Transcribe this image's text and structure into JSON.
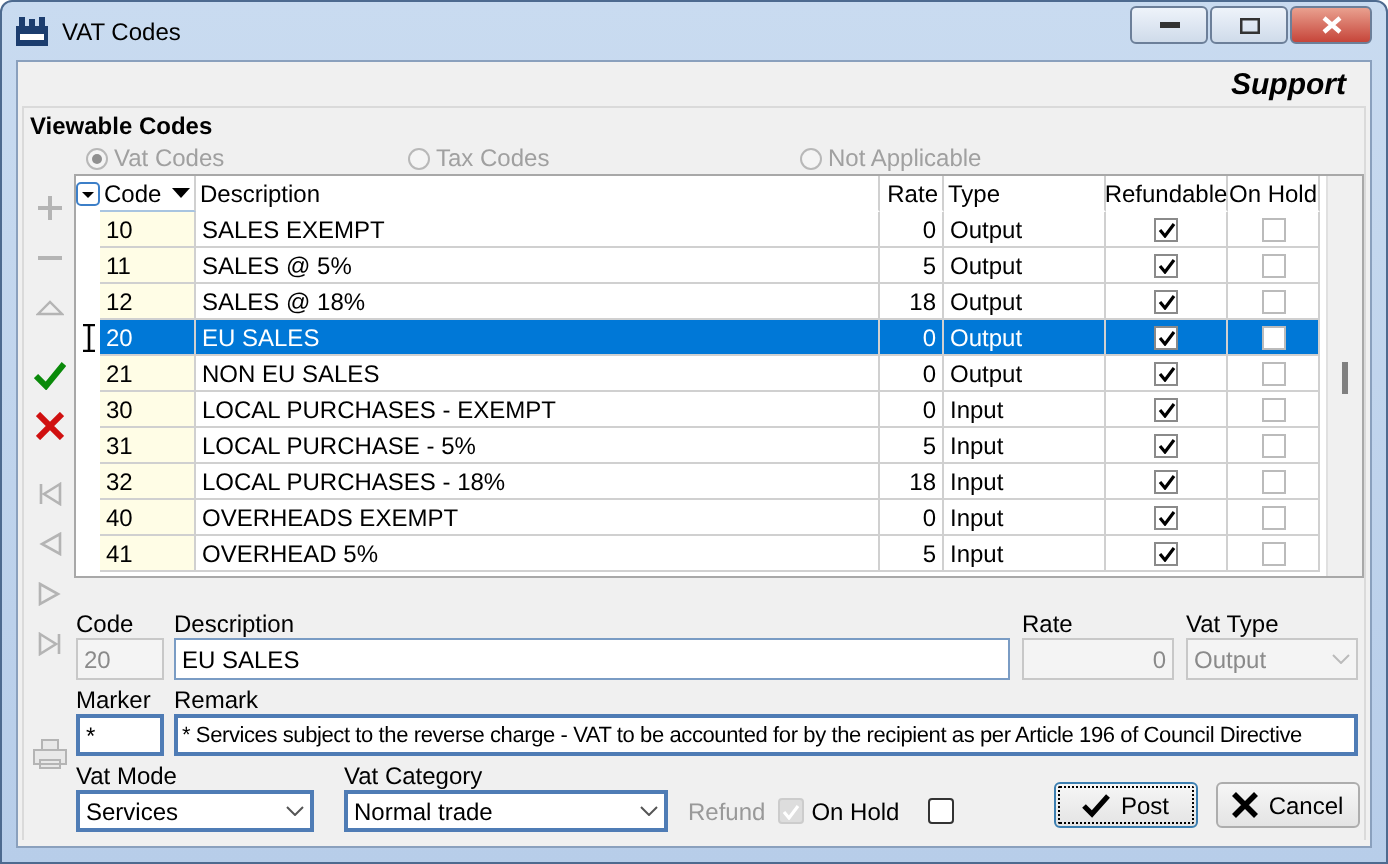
{
  "window": {
    "title": "VAT Codes"
  },
  "header": {
    "text": "Support"
  },
  "viewable_codes": {
    "title": "Viewable Codes",
    "options": [
      {
        "label": "Vat Codes",
        "selected": true,
        "disabled": true
      },
      {
        "label": "Tax Codes",
        "selected": false,
        "disabled": true
      },
      {
        "label": "Not Applicable",
        "selected": false,
        "disabled": true
      }
    ]
  },
  "toolbar": [
    [
      {
        "kind": "add",
        "disabled": true
      },
      {
        "kind": "remove",
        "disabled": true
      },
      {
        "kind": "up",
        "disabled": true
      }
    ],
    [
      {
        "kind": "confirm",
        "disabled": false
      },
      {
        "kind": "cancel",
        "disabled": false
      }
    ],
    [
      {
        "kind": "first",
        "disabled": true
      },
      {
        "kind": "previous",
        "disabled": true
      },
      {
        "kind": "next",
        "disabled": true
      },
      {
        "kind": "last",
        "disabled": true
      }
    ],
    [
      {
        "kind": "print",
        "disabled": true
      }
    ]
  ],
  "table": {
    "columns": [
      "Code",
      "Description",
      "Rate",
      "Type",
      "Refundable",
      "On Hold"
    ],
    "rows": [
      {
        "code": "10",
        "description": "SALES EXEMPT",
        "rate": "0",
        "type": "Output",
        "refundable": true,
        "on_hold": false,
        "selected": false
      },
      {
        "code": "11",
        "description": "SALES @ 5%",
        "rate": "5",
        "type": "Output",
        "refundable": true,
        "on_hold": false,
        "selected": false
      },
      {
        "code": "12",
        "description": "SALES @ 18%",
        "rate": "18",
        "type": "Output",
        "refundable": true,
        "on_hold": false,
        "selected": false
      },
      {
        "code": "20",
        "description": "EU SALES",
        "rate": "0",
        "type": "Output",
        "refundable": true,
        "on_hold": false,
        "selected": true
      },
      {
        "code": "21",
        "description": "NON EU SALES",
        "rate": "0",
        "type": "Output",
        "refundable": true,
        "on_hold": false,
        "selected": false
      },
      {
        "code": "30",
        "description": "LOCAL PURCHASES - EXEMPT",
        "rate": "0",
        "type": "Input",
        "refundable": true,
        "on_hold": false,
        "selected": false
      },
      {
        "code": "31",
        "description": "LOCAL PURCHASE - 5%",
        "rate": "5",
        "type": "Input",
        "refundable": true,
        "on_hold": false,
        "selected": false
      },
      {
        "code": "32",
        "description": "LOCAL PURCHASES - 18%",
        "rate": "18",
        "type": "Input",
        "refundable": true,
        "on_hold": false,
        "selected": false
      },
      {
        "code": "40",
        "description": "OVERHEADS EXEMPT",
        "rate": "0",
        "type": "Input",
        "refundable": true,
        "on_hold": false,
        "selected": false
      },
      {
        "code": "41",
        "description": "OVERHEAD 5%",
        "rate": "5",
        "type": "Input",
        "refundable": true,
        "on_hold": false,
        "selected": false
      }
    ]
  },
  "form": {
    "code": {
      "label": "Code",
      "value": "20",
      "disabled": true
    },
    "description": {
      "label": "Description",
      "value": "EU SALES",
      "disabled": false
    },
    "rate": {
      "label": "Rate",
      "value": "0",
      "disabled": true
    },
    "vat_type": {
      "label": "Vat Type",
      "value": "Output",
      "disabled": true
    },
    "marker": {
      "label": "Marker",
      "value": "*",
      "disabled": false
    },
    "remark": {
      "label": "Remark",
      "value": "* Services subject to the reverse charge - VAT to be accounted for by the recipient as per Article 196 of Council Directive",
      "disabled": false
    },
    "vat_mode": {
      "label": "Vat Mode",
      "value": "Services",
      "disabled": false
    },
    "vat_category": {
      "label": "Vat Category",
      "value": "Normal trade",
      "disabled": false
    },
    "refund": {
      "label": "Refund",
      "checked": true,
      "disabled": true
    },
    "on_hold": {
      "label": "On Hold",
      "checked": false,
      "disabled": false
    }
  },
  "buttons": [
    {
      "kind": "post",
      "label": "Post"
    },
    {
      "kind": "cancel",
      "label": "Cancel"
    }
  ]
}
